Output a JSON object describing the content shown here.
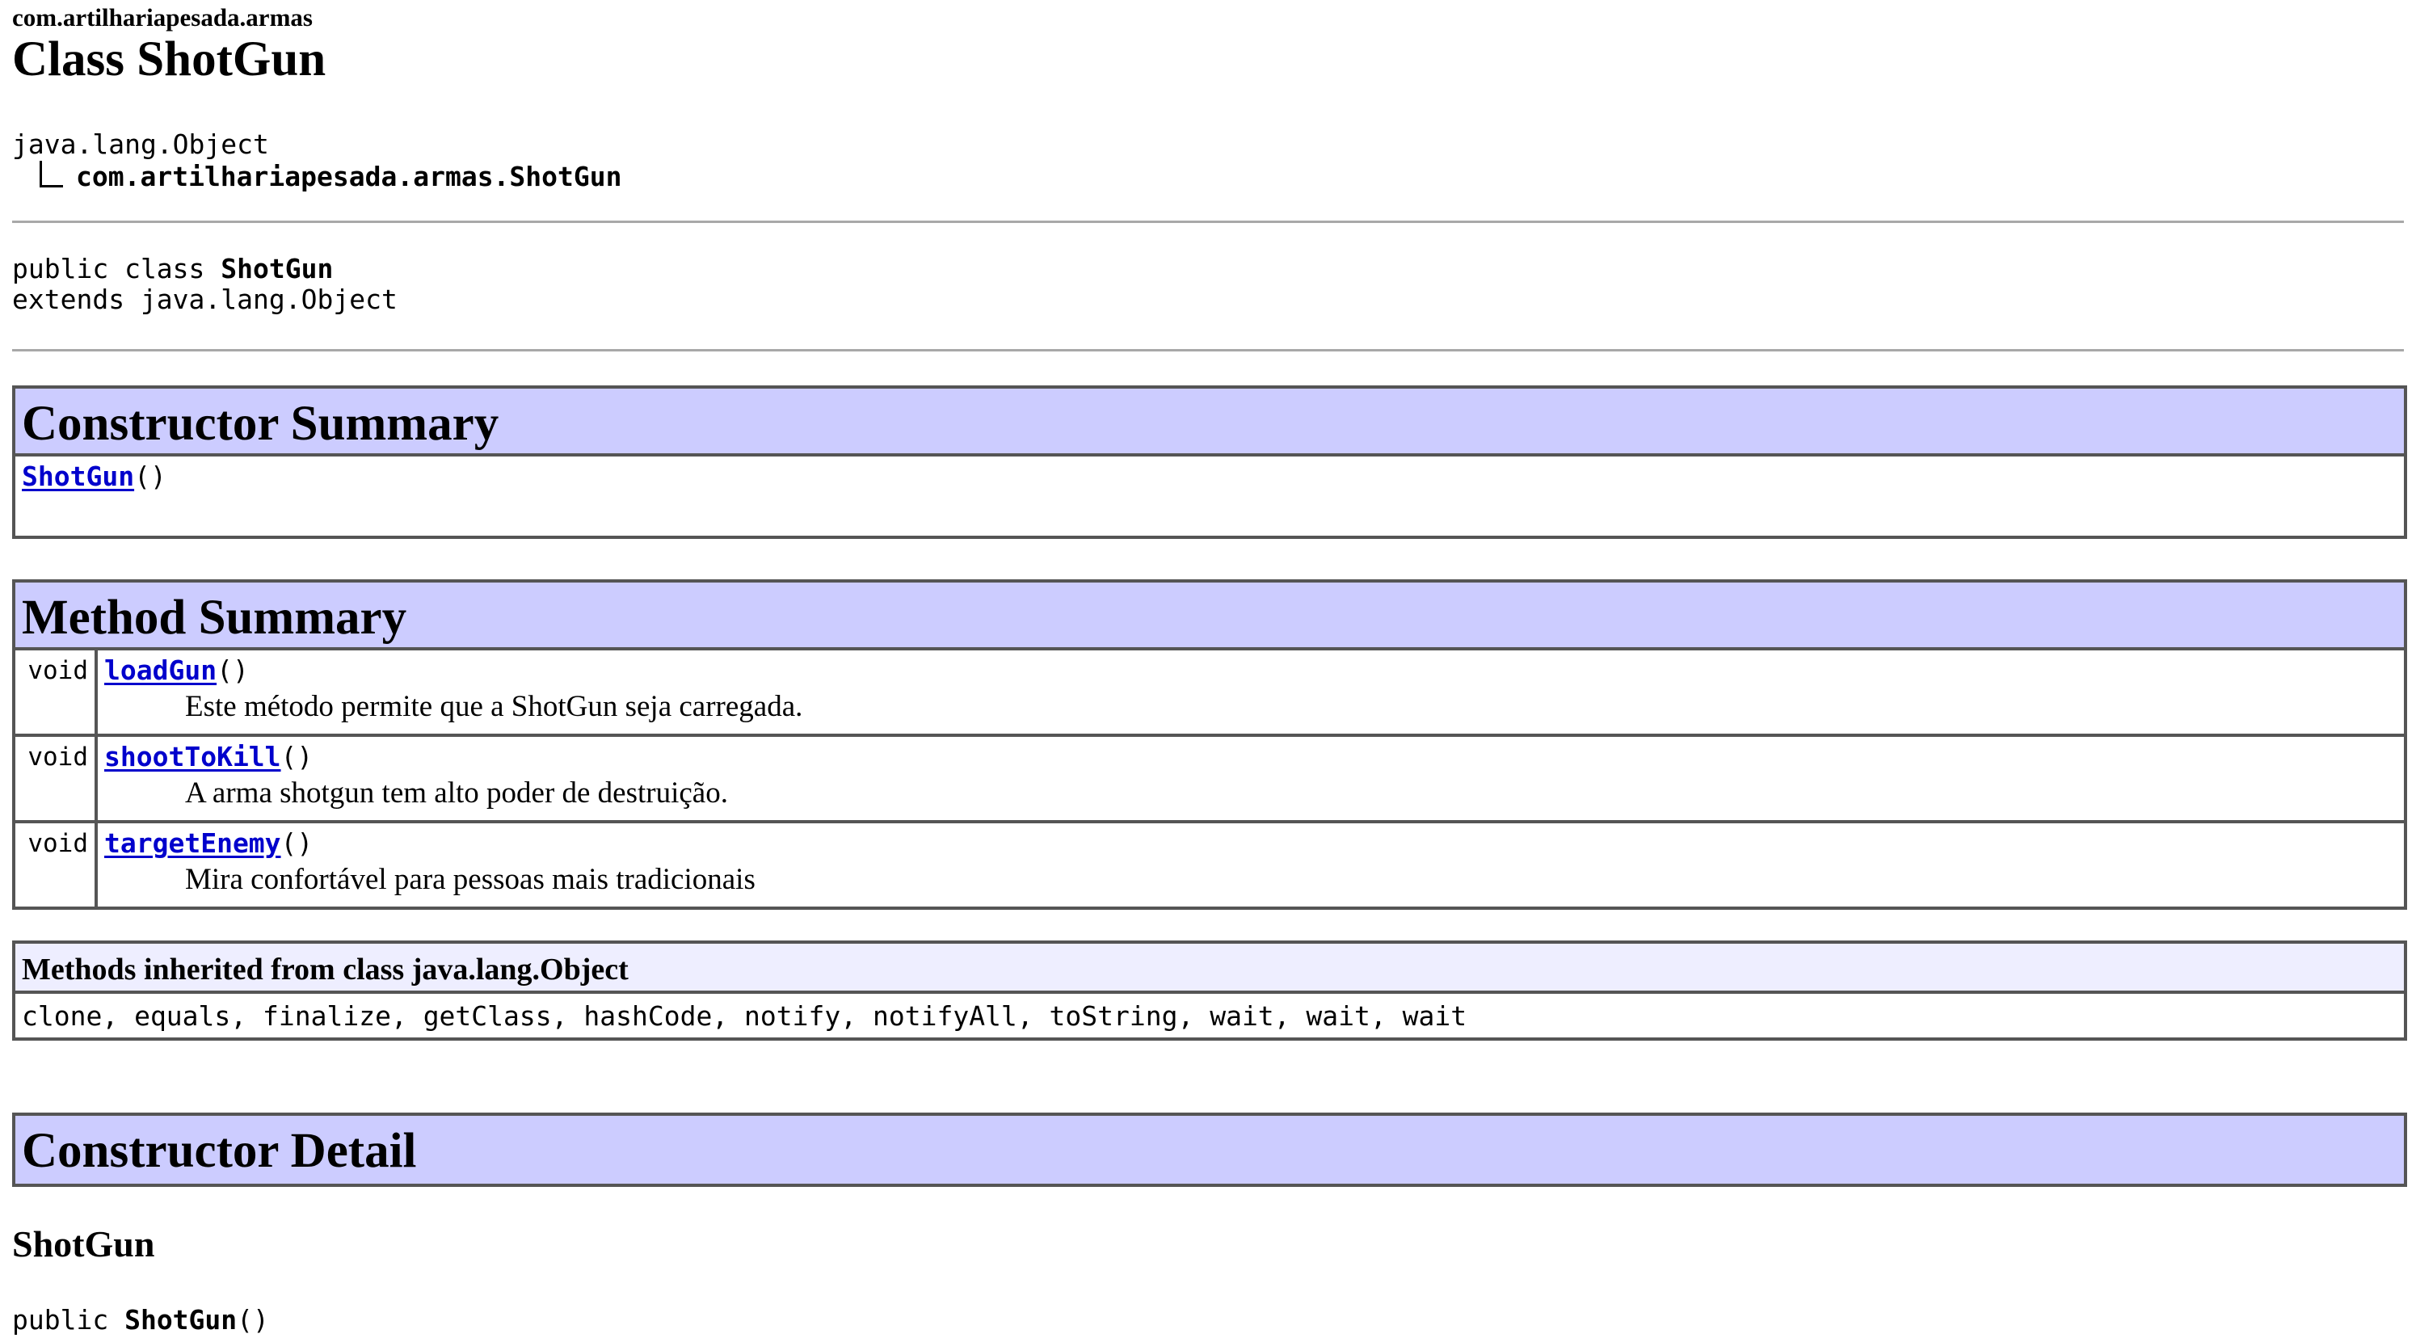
{
  "header": {
    "package": "com.artilhariapesada.armas",
    "class_title": "Class ShotGun"
  },
  "inheritance": {
    "root": "java.lang.Object",
    "child": "com.artilhariapesada.armas.ShotGun"
  },
  "declaration": {
    "line1_prefix": "public class ",
    "line1_name": "ShotGun",
    "line2": "extends java.lang.Object"
  },
  "constructor_summary": {
    "title": "Constructor Summary",
    "name": "ShotGun",
    "params": "()"
  },
  "method_summary": {
    "title": "Method Summary",
    "methods": [
      {
        "type": "void",
        "name": "loadGun",
        "params": "()",
        "description": "Este método permite que a ShotGun seja carregada."
      },
      {
        "type": "void",
        "name": "shootToKill",
        "params": "()",
        "description": "A arma shotgun tem alto poder de destruição."
      },
      {
        "type": "void",
        "name": "targetEnemy",
        "params": "()",
        "description": "Mira confortável para pessoas mais tradicionais"
      }
    ]
  },
  "inherited": {
    "title": "Methods inherited from class java.lang.Object",
    "methods": "clone, equals, finalize, getClass, hashCode, notify, notifyAll, toString, wait, wait, wait"
  },
  "constructor_detail": {
    "title": "Constructor Detail",
    "name": "ShotGun",
    "sig_prefix": "public ",
    "sig_name": "ShotGun",
    "sig_params": "()"
  },
  "colors": {
    "table_header": "#ccccff",
    "inherited_header": "#eeeeff",
    "link": "#0000cc",
    "border": "#555555"
  }
}
